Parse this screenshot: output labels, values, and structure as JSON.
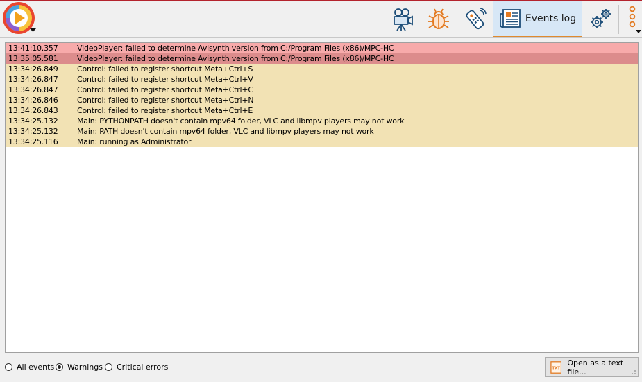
{
  "toolbar": {
    "active_tab": "Events log",
    "buttons": [
      {
        "name": "player",
        "icon": "video-camera-icon"
      },
      {
        "name": "debug",
        "icon": "bug-icon"
      },
      {
        "name": "remote",
        "icon": "remote-control-icon"
      },
      {
        "name": "events-log",
        "icon": "newspaper-icon",
        "label": "Events log"
      },
      {
        "name": "settings",
        "icon": "gears-icon"
      },
      {
        "name": "more",
        "icon": "vertical-dots-icon"
      }
    ]
  },
  "colors": {
    "accent": "#e37a21",
    "critical_row": "#f7aaaa",
    "critical_row_selected": "#dc8c8c",
    "warning_row": "#f2e2b4",
    "active_tab_bg": "#d7e7f6"
  },
  "log": {
    "entries": [
      {
        "time": "13:41:10.357",
        "message": "VideoPlayer: failed to determine Avisynth version from C:/Program Files (x86)/MPC-HC",
        "level": "critical"
      },
      {
        "time": "13:35:05.581",
        "message": "VideoPlayer: failed to determine Avisynth version from C:/Program Files (x86)/MPC-HC",
        "level": "critical"
      },
      {
        "time": "13:34:26.849",
        "message": "Control: failed to register shortcut Meta+Ctrl+S",
        "level": "warning"
      },
      {
        "time": "13:34:26.847",
        "message": "Control: failed to register shortcut Meta+Ctrl+V",
        "level": "warning"
      },
      {
        "time": "13:34:26.847",
        "message": "Control: failed to register shortcut Meta+Ctrl+C",
        "level": "warning"
      },
      {
        "time": "13:34:26.846",
        "message": "Control: failed to register shortcut Meta+Ctrl+N",
        "level": "warning"
      },
      {
        "time": "13:34:26.843",
        "message": "Control: failed to register shortcut Meta+Ctrl+E",
        "level": "warning"
      },
      {
        "time": "13:34:25.132",
        "message": "Main: PYTHONPATH doesn't contain mpv64 folder, VLC and libmpv players may not work",
        "level": "warning"
      },
      {
        "time": "13:34:25.132",
        "message": "Main: PATH doesn't contain mpv64 folder, VLC and libmpv players may not work",
        "level": "warning"
      },
      {
        "time": "13:34:25.116",
        "message": "Main: running as Administrator",
        "level": "warning"
      }
    ],
    "selected_index": 1
  },
  "filter": {
    "options": [
      "All events",
      "Warnings",
      "Critical errors"
    ],
    "selected": "Warnings"
  },
  "open_text_file": {
    "label": "Open as a text file...",
    "icon_text": "TXT"
  }
}
